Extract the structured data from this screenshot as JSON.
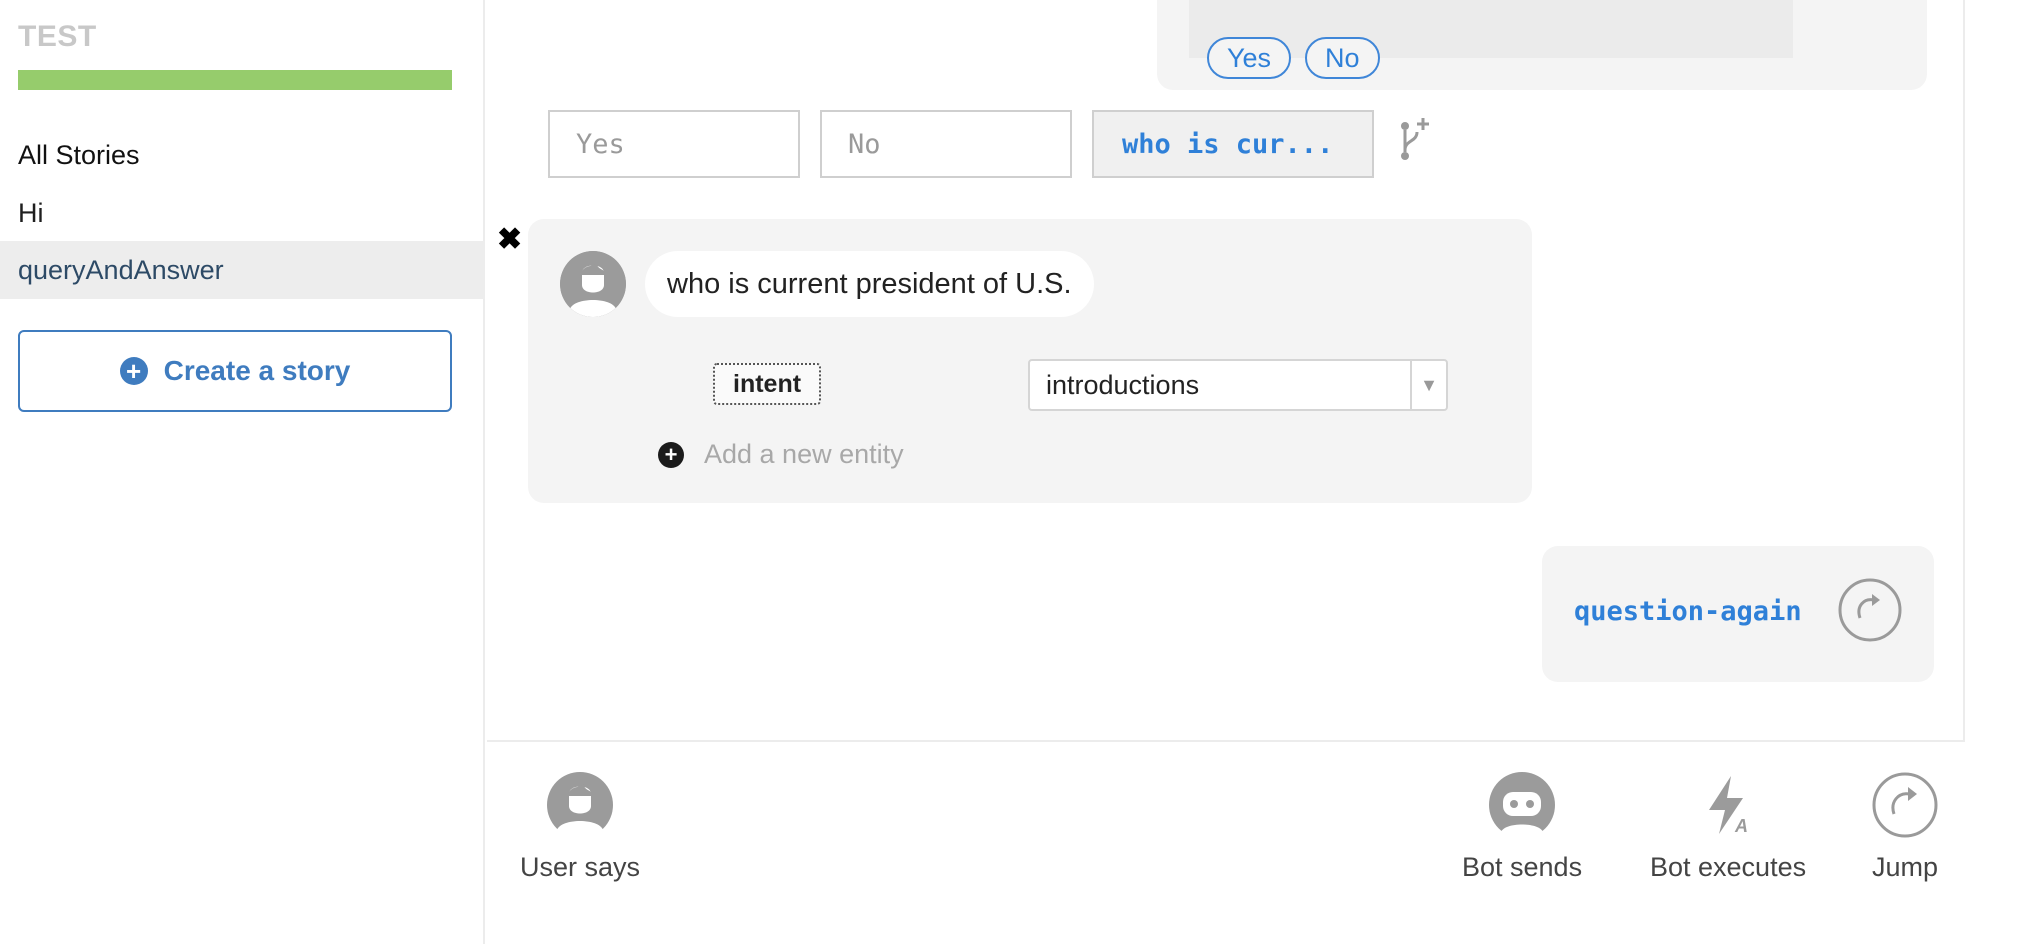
{
  "sidebar": {
    "project_name": "TEST",
    "progress_percent": 100,
    "stories": [
      {
        "label": "All Stories"
      },
      {
        "label": "Hi"
      },
      {
        "label": "queryAndAnswer"
      }
    ],
    "create_story_label": "Create a story"
  },
  "bot_response_top": {
    "buttons": [
      "Yes",
      "No"
    ]
  },
  "branches": [
    {
      "label": "Yes"
    },
    {
      "label": "No"
    },
    {
      "label": "who is cur..."
    }
  ],
  "user_utterance": {
    "text": "who is current president of U.S.",
    "intent_label": "intent",
    "intent_value": "introductions",
    "add_entity_placeholder": "Add a new entity"
  },
  "jump": {
    "target": "question-again"
  },
  "toolbar": {
    "user_says": "User says",
    "bot_sends": "Bot sends",
    "bot_executes": "Bot executes",
    "jump": "Jump"
  },
  "icons": {
    "create": "plus-circle-icon",
    "branch_add": "branch-add-icon",
    "remove": "close-icon",
    "user": "user-avatar-icon",
    "bot": "robot-icon",
    "action": "lightning-icon",
    "jump": "redo-arrow-icon"
  },
  "colors": {
    "accent": "#2f80d8",
    "progress": "#96cc6c",
    "panel": "#f4f4f4"
  }
}
